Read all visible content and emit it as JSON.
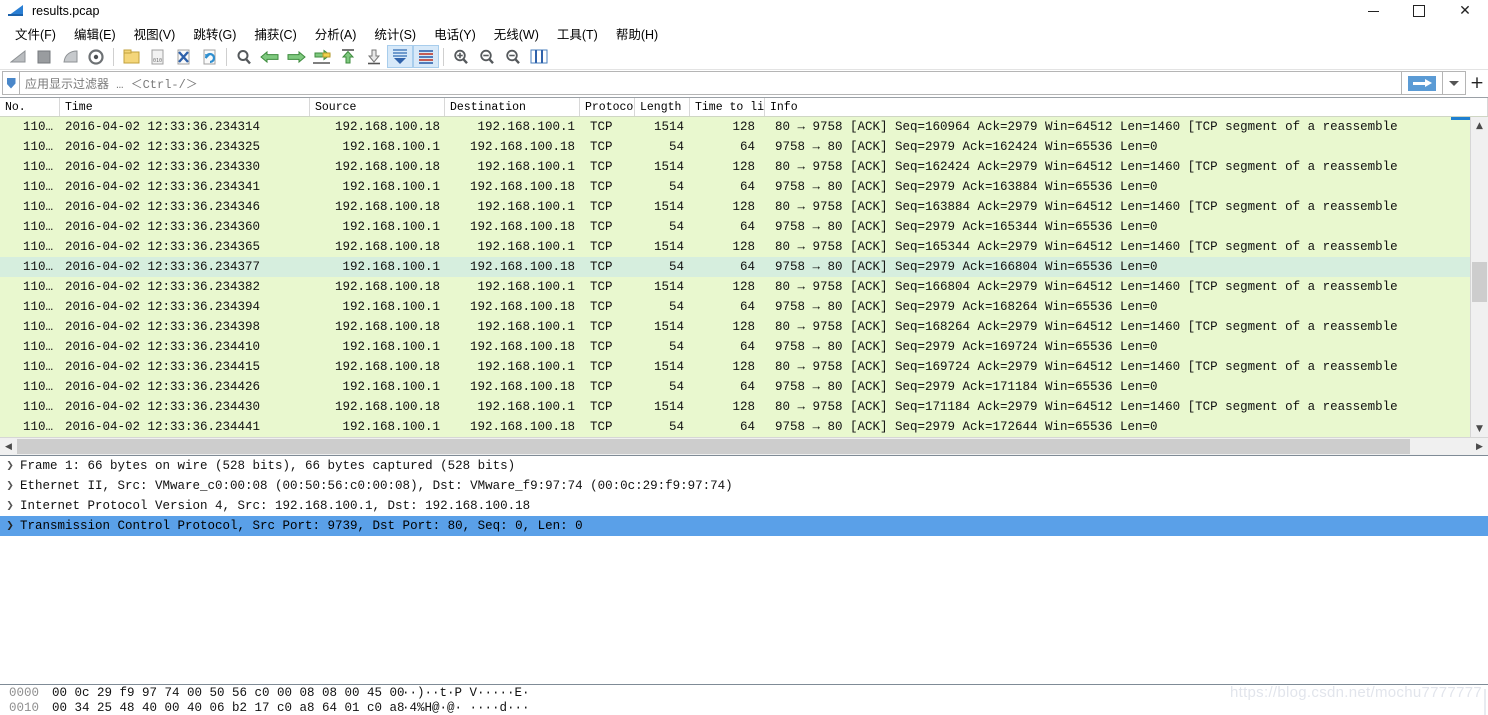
{
  "window": {
    "title": "results.pcap",
    "icon": "wireshark-fin-icon",
    "minimize": "–",
    "maximize": "□",
    "close": "✕"
  },
  "menu": [
    {
      "label": "文件(F)"
    },
    {
      "label": "编辑(E)"
    },
    {
      "label": "视图(V)"
    },
    {
      "label": "跳转(G)"
    },
    {
      "label": "捕获(C)"
    },
    {
      "label": "分析(A)"
    },
    {
      "label": "统计(S)"
    },
    {
      "label": "电话(Y)"
    },
    {
      "label": "无线(W)"
    },
    {
      "label": "工具(T)"
    },
    {
      "label": "帮助(H)"
    }
  ],
  "toolbar": {
    "items": [
      {
        "name": "start-capture-icon",
        "glyph": "start"
      },
      {
        "name": "stop-capture-icon",
        "glyph": "stop"
      },
      {
        "name": "restart-capture-icon",
        "glyph": "restart"
      },
      {
        "name": "capture-options-icon",
        "glyph": "options"
      },
      {
        "name": "open-file-icon",
        "glyph": "folder"
      },
      {
        "name": "save-file-icon",
        "glyph": "save"
      },
      {
        "name": "close-file-icon",
        "glyph": "close-x"
      },
      {
        "name": "reload-file-icon",
        "glyph": "reload"
      },
      {
        "name": "find-packet-icon",
        "glyph": "magnifier"
      },
      {
        "name": "go-back-icon",
        "glyph": "arrow-left"
      },
      {
        "name": "go-forward-icon",
        "glyph": "arrow-right"
      },
      {
        "name": "go-to-packet-icon",
        "glyph": "goto"
      },
      {
        "name": "go-to-first-icon",
        "glyph": "first"
      },
      {
        "name": "go-to-last-icon",
        "glyph": "last"
      },
      {
        "name": "auto-scroll-icon",
        "glyph": "autoscroll"
      },
      {
        "name": "colorize-icon",
        "glyph": "colorize"
      },
      {
        "name": "zoom-in-icon",
        "glyph": "zoom-in"
      },
      {
        "name": "zoom-out-icon",
        "glyph": "zoom-out"
      },
      {
        "name": "zoom-reset-icon",
        "glyph": "zoom-reset"
      },
      {
        "name": "resize-columns-icon",
        "glyph": "resize-cols"
      }
    ]
  },
  "filter": {
    "value": "",
    "placeholder": "应用显示过滤器 … ＜Ctrl-/＞",
    "bookmark_icon": "bookmark-icon",
    "apply_icon": "apply-arrow-icon",
    "dropdown_icon": "chevron-down-icon",
    "add_icon": "plus-icon"
  },
  "packet_list": {
    "columns": [
      "No.",
      "Time",
      "Source",
      "Destination",
      "Protocol",
      "Length",
      "Time to live",
      "Info"
    ],
    "rows": [
      {
        "no": "110…",
        "time": "2016-04-02 12:33:36.234314",
        "src": "192.168.100.18",
        "dst": "192.168.100.1",
        "proto": "TCP",
        "len": "1514",
        "ttl": "128",
        "info": "80 → 9758 [ACK] Seq=160964 Ack=2979 Win=64512 Len=1460 [TCP segment of a reassemble",
        "selected": false
      },
      {
        "no": "110…",
        "time": "2016-04-02 12:33:36.234325",
        "src": "192.168.100.1",
        "dst": "192.168.100.18",
        "proto": "TCP",
        "len": "54",
        "ttl": "64",
        "info": "9758 → 80 [ACK] Seq=2979 Ack=162424 Win=65536 Len=0",
        "selected": false
      },
      {
        "no": "110…",
        "time": "2016-04-02 12:33:36.234330",
        "src": "192.168.100.18",
        "dst": "192.168.100.1",
        "proto": "TCP",
        "len": "1514",
        "ttl": "128",
        "info": "80 → 9758 [ACK] Seq=162424 Ack=2979 Win=64512 Len=1460 [TCP segment of a reassemble",
        "selected": false
      },
      {
        "no": "110…",
        "time": "2016-04-02 12:33:36.234341",
        "src": "192.168.100.1",
        "dst": "192.168.100.18",
        "proto": "TCP",
        "len": "54",
        "ttl": "64",
        "info": "9758 → 80 [ACK] Seq=2979 Ack=163884 Win=65536 Len=0",
        "selected": false
      },
      {
        "no": "110…",
        "time": "2016-04-02 12:33:36.234346",
        "src": "192.168.100.18",
        "dst": "192.168.100.1",
        "proto": "TCP",
        "len": "1514",
        "ttl": "128",
        "info": "80 → 9758 [ACK] Seq=163884 Ack=2979 Win=64512 Len=1460 [TCP segment of a reassemble",
        "selected": false
      },
      {
        "no": "110…",
        "time": "2016-04-02 12:33:36.234360",
        "src": "192.168.100.1",
        "dst": "192.168.100.18",
        "proto": "TCP",
        "len": "54",
        "ttl": "64",
        "info": "9758 → 80 [ACK] Seq=2979 Ack=165344 Win=65536 Len=0",
        "selected": false
      },
      {
        "no": "110…",
        "time": "2016-04-02 12:33:36.234365",
        "src": "192.168.100.18",
        "dst": "192.168.100.1",
        "proto": "TCP",
        "len": "1514",
        "ttl": "128",
        "info": "80 → 9758 [ACK] Seq=165344 Ack=2979 Win=64512 Len=1460 [TCP segment of a reassemble",
        "selected": false
      },
      {
        "no": "110…",
        "time": "2016-04-02 12:33:36.234377",
        "src": "192.168.100.1",
        "dst": "192.168.100.18",
        "proto": "TCP",
        "len": "54",
        "ttl": "64",
        "info": "9758 → 80 [ACK] Seq=2979 Ack=166804 Win=65536 Len=0",
        "selected": true
      },
      {
        "no": "110…",
        "time": "2016-04-02 12:33:36.234382",
        "src": "192.168.100.18",
        "dst": "192.168.100.1",
        "proto": "TCP",
        "len": "1514",
        "ttl": "128",
        "info": "80 → 9758 [ACK] Seq=166804 Ack=2979 Win=64512 Len=1460 [TCP segment of a reassemble",
        "selected": false
      },
      {
        "no": "110…",
        "time": "2016-04-02 12:33:36.234394",
        "src": "192.168.100.1",
        "dst": "192.168.100.18",
        "proto": "TCP",
        "len": "54",
        "ttl": "64",
        "info": "9758 → 80 [ACK] Seq=2979 Ack=168264 Win=65536 Len=0",
        "selected": false
      },
      {
        "no": "110…",
        "time": "2016-04-02 12:33:36.234398",
        "src": "192.168.100.18",
        "dst": "192.168.100.1",
        "proto": "TCP",
        "len": "1514",
        "ttl": "128",
        "info": "80 → 9758 [ACK] Seq=168264 Ack=2979 Win=64512 Len=1460 [TCP segment of a reassemble",
        "selected": false
      },
      {
        "no": "110…",
        "time": "2016-04-02 12:33:36.234410",
        "src": "192.168.100.1",
        "dst": "192.168.100.18",
        "proto": "TCP",
        "len": "54",
        "ttl": "64",
        "info": "9758 → 80 [ACK] Seq=2979 Ack=169724 Win=65536 Len=0",
        "selected": false
      },
      {
        "no": "110…",
        "time": "2016-04-02 12:33:36.234415",
        "src": "192.168.100.18",
        "dst": "192.168.100.1",
        "proto": "TCP",
        "len": "1514",
        "ttl": "128",
        "info": "80 → 9758 [ACK] Seq=169724 Ack=2979 Win=64512 Len=1460 [TCP segment of a reassemble",
        "selected": false
      },
      {
        "no": "110…",
        "time": "2016-04-02 12:33:36.234426",
        "src": "192.168.100.1",
        "dst": "192.168.100.18",
        "proto": "TCP",
        "len": "54",
        "ttl": "64",
        "info": "9758 → 80 [ACK] Seq=2979 Ack=171184 Win=65536 Len=0",
        "selected": false
      },
      {
        "no": "110…",
        "time": "2016-04-02 12:33:36.234430",
        "src": "192.168.100.18",
        "dst": "192.168.100.1",
        "proto": "TCP",
        "len": "1514",
        "ttl": "128",
        "info": "80 → 9758 [ACK] Seq=171184 Ack=2979 Win=64512 Len=1460 [TCP segment of a reassemble",
        "selected": false
      },
      {
        "no": "110…",
        "time": "2016-04-02 12:33:36.234441",
        "src": "192.168.100.1",
        "dst": "192.168.100.18",
        "proto": "TCP",
        "len": "54",
        "ttl": "64",
        "info": "9758 → 80 [ACK] Seq=2979 Ack=172644 Win=65536 Len=0",
        "selected": false
      }
    ]
  },
  "packet_detail": {
    "rows": [
      {
        "text": "Frame 1: 66 bytes on wire (528 bits), 66 bytes captured (528 bits)",
        "selected": false
      },
      {
        "text": "Ethernet II, Src: VMware_c0:00:08 (00:50:56:c0:00:08), Dst: VMware_f9:97:74 (00:0c:29:f9:97:74)",
        "selected": false
      },
      {
        "text": "Internet Protocol Version 4, Src: 192.168.100.1, Dst: 192.168.100.18",
        "selected": false
      },
      {
        "text": "Transmission Control Protocol, Src Port: 9739, Dst Port: 80, Seq: 0, Len: 0",
        "selected": true
      }
    ]
  },
  "packet_bytes": {
    "rows": [
      {
        "offset": "0000",
        "hex": "00 0c 29 f9 97 74 00 50  56 c0 00 08 08 00 45 00",
        "ascii": "··)··t·P V·····E·"
      },
      {
        "offset": "0010",
        "hex": "00 34 25 48 40 00 40 06  b2 17 c0 a8 64 01 c0 a8",
        "ascii": "·4%H@·@· ····d···"
      }
    ]
  },
  "watermark": {
    "text": "https://blog.csdn.net/mochu7777777"
  },
  "colors": {
    "packet_row_bg": "#e9f8cf",
    "packet_row_selected_bg": "#d6eede",
    "detail_selected_bg": "#5aa0e8",
    "accent": "#1e7fd0"
  }
}
